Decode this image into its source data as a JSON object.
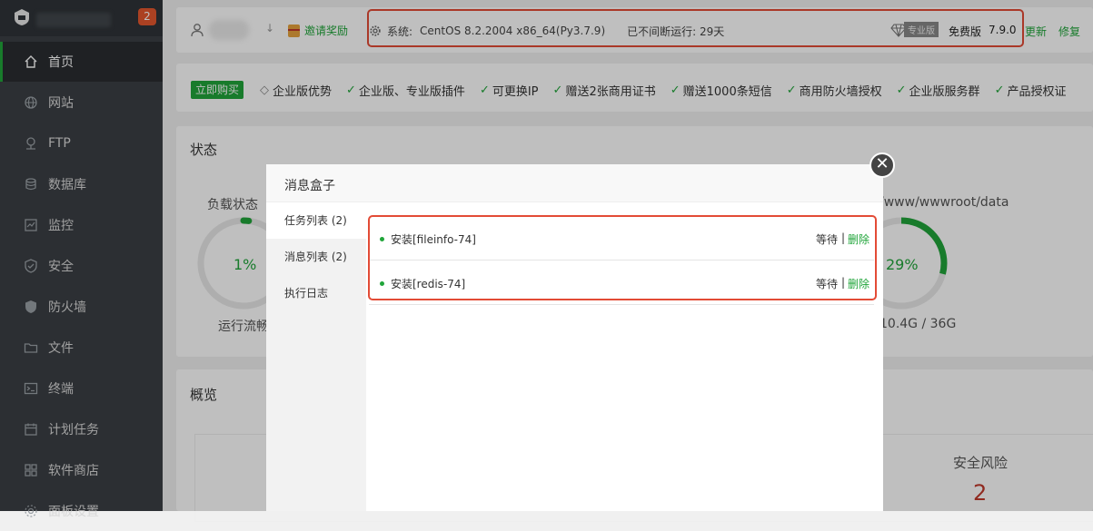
{
  "sidebar": {
    "badge_count": "2",
    "items": [
      {
        "label": "首页",
        "icon": "home-icon"
      },
      {
        "label": "网站",
        "icon": "globe-icon"
      },
      {
        "label": "FTP",
        "icon": "ftp-icon"
      },
      {
        "label": "数据库",
        "icon": "database-icon"
      },
      {
        "label": "监控",
        "icon": "monitor-icon"
      },
      {
        "label": "安全",
        "icon": "shield-check-icon"
      },
      {
        "label": "防火墙",
        "icon": "firewall-icon"
      },
      {
        "label": "文件",
        "icon": "folder-icon"
      },
      {
        "label": "终端",
        "icon": "terminal-icon"
      },
      {
        "label": "计划任务",
        "icon": "calendar-icon"
      },
      {
        "label": "软件商店",
        "icon": "apps-icon"
      },
      {
        "label": "面板设置",
        "icon": "settings-icon"
      }
    ],
    "active_index": 0
  },
  "topbar": {
    "down_arrow": "↓",
    "invite_label": "邀请奖励",
    "system_label": "系统:",
    "system_value": "CentOS 8.2.2004 x86_64(Py3.7.9)",
    "uptime": "已不间断运行: 29天",
    "pro_label": "专业版",
    "free_label": "免费版",
    "version": "7.9.0",
    "update_label": "更新",
    "repair_label": "修复"
  },
  "promo": {
    "buy_label": "立即购买",
    "items": [
      "企业版优势",
      "企业版、专业版插件",
      "可更换IP",
      "赠送2张商用证书",
      "赠送1000条短信",
      "商用防火墙授权",
      "企业版服务群",
      "产品授权证"
    ]
  },
  "status": {
    "title": "状态",
    "load_label": "负载状态",
    "load_value": "1%",
    "load_fraction": 0.01,
    "run_label": "运行流畅",
    "disk_path": "/www/wwwroot/data",
    "disk_value": "29%",
    "disk_fraction": 0.29,
    "disk_size": "10.4G / 36G"
  },
  "overview": {
    "title": "概览",
    "risk_label": "安全风险",
    "risk_value": "2"
  },
  "modal": {
    "title": "消息盒子",
    "close_glyph": "✕",
    "tabs": [
      "任务列表 (2)",
      "消息列表 (2)",
      "执行日志"
    ],
    "active_tab": 0,
    "tasks": [
      {
        "name": "安装[fileinfo-74]",
        "status": "等待",
        "sep": "|",
        "action": "删除"
      },
      {
        "name": "安装[redis-74]",
        "status": "等待",
        "sep": "|",
        "action": "删除"
      }
    ]
  },
  "colors": {
    "accent": "#20a53a",
    "highlight": "#e34b36",
    "sidebar": "#3b3f44"
  }
}
